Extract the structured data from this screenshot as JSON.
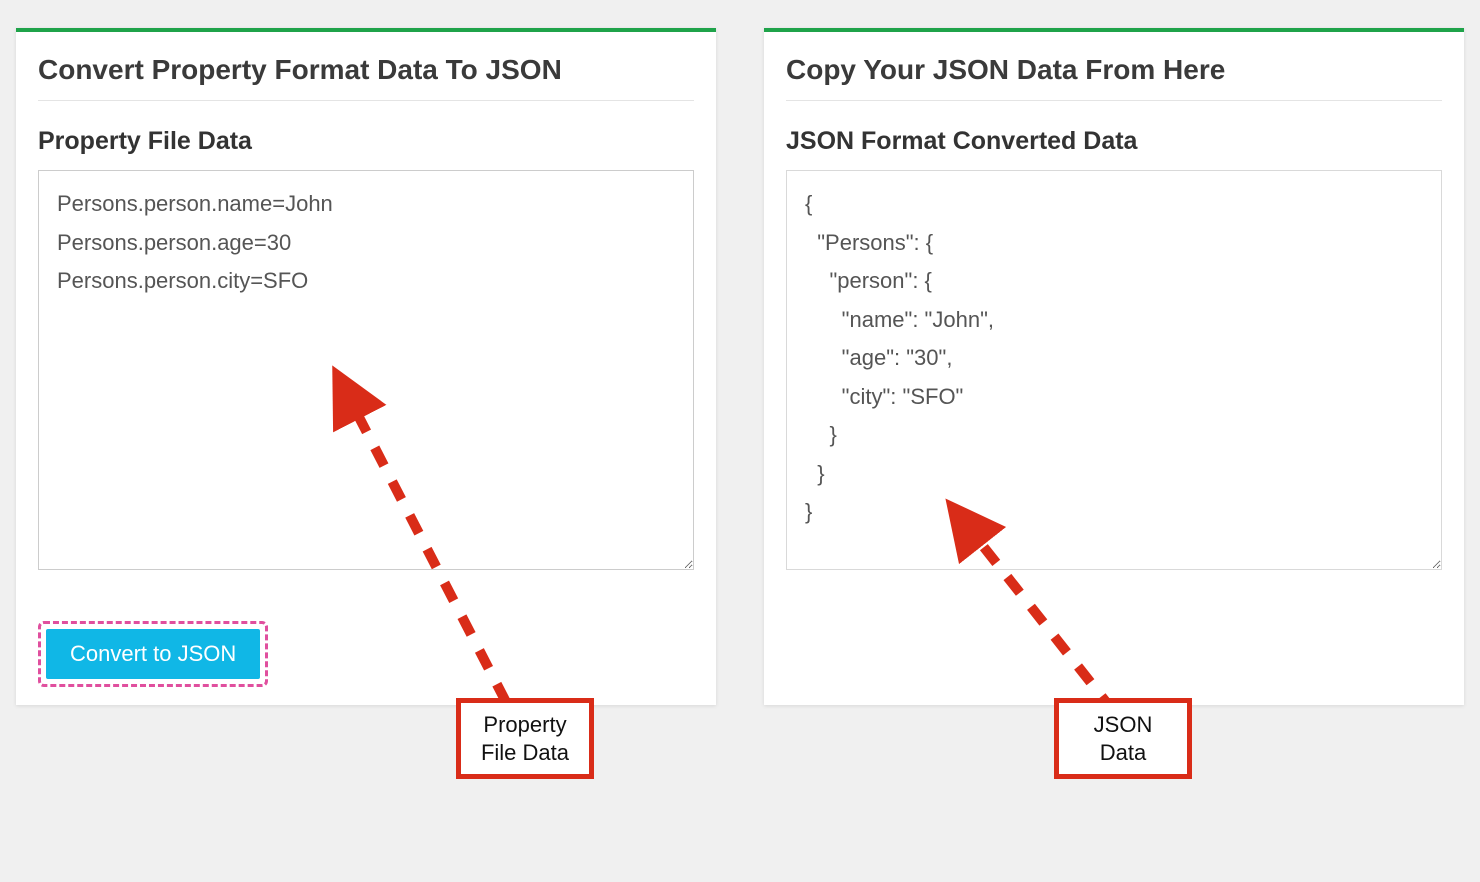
{
  "left_panel": {
    "title": "Convert Property Format Data To JSON",
    "subtitle": "Property File Data",
    "textarea_value": "Persons.person.name=John\nPersons.person.age=30\nPersons.person.city=SFO",
    "button_label": "Convert to JSON",
    "annotation_text": "Property\nFile Data"
  },
  "right_panel": {
    "title": "Copy Your JSON Data From Here",
    "subtitle": "JSON Format Converted Data",
    "textarea_value": "{\n  \"Persons\": {\n    \"person\": {\n      \"name\": \"John\",\n      \"age\": \"30\",\n      \"city\": \"SFO\"\n    }\n  }\n}",
    "annotation_text": "JSON\nData"
  },
  "colors": {
    "accent_green": "#1fa34a",
    "button_blue": "#10b7e6",
    "highlight_pink": "#e04f9e",
    "annotation_red": "#d92c18"
  }
}
